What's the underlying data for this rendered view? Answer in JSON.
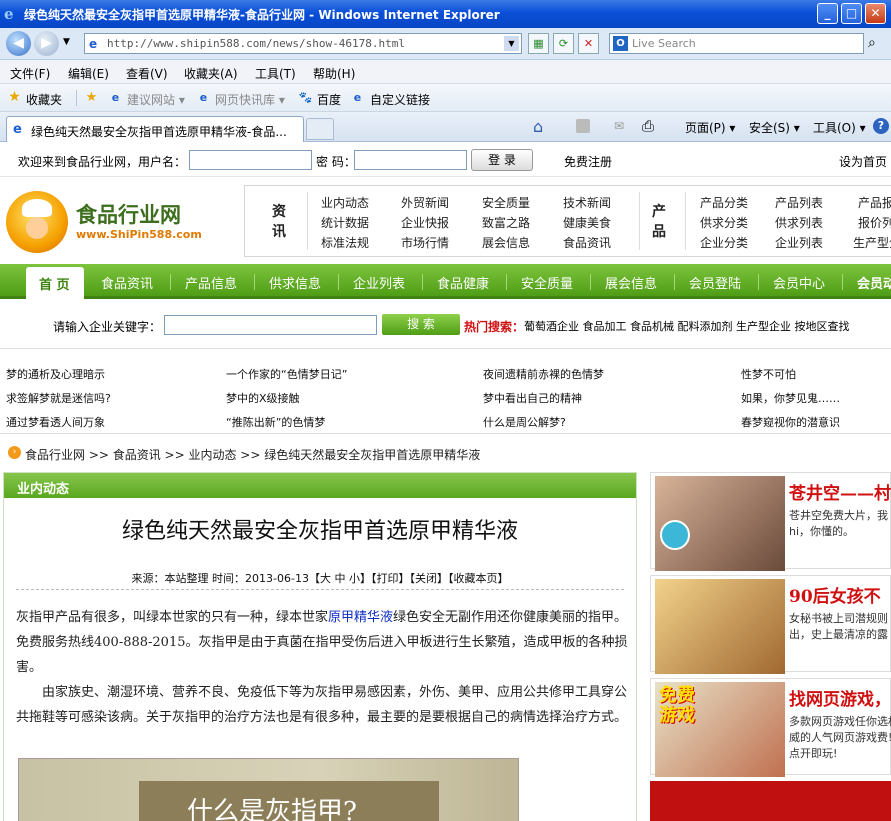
{
  "window": {
    "title": "绿色纯天然最安全灰指甲首选原甲精华液-食品行业网 - Windows Internet Explorer",
    "min": "_",
    "max": "□",
    "close": "✕"
  },
  "address": {
    "url": "http://www.shipin588.com/news/show-46178.html",
    "search_placeholder": "Live Search"
  },
  "menu": [
    "文件(F)",
    "编辑(E)",
    "查看(V)",
    "收藏夹(A)",
    "工具(T)",
    "帮助(H)"
  ],
  "favorites": {
    "label": "收藏夹",
    "items": [
      "建议网站 ▾",
      "网页快讯库 ▾",
      "百度",
      "自定义链接"
    ]
  },
  "tab": {
    "title": "绿色纯天然最安全灰指甲首选原甲精华液-食品...",
    "commands": [
      "页面(P) ▾",
      "安全(S) ▾",
      "工具(O) ▾"
    ]
  },
  "site": {
    "welcome": "欢迎来到食品行业网，用户名：",
    "password_label": "密 码：",
    "login_button": "登 录",
    "register": "免费注册",
    "set_home": "设为首页",
    "logo_name": "食品行业网",
    "logo_url": "www.ShiPin588.com",
    "cat1_label": "资讯",
    "cat1_links": [
      "业内动态",
      "外贸新闻",
      "安全质量",
      "技术新闻",
      "统计数据",
      "企业快报",
      "致富之路",
      "健康美食",
      "标准法规",
      "市场行情",
      "展会信息",
      "食品资讯"
    ],
    "cat2_label": "产品",
    "cat2_links": [
      "产品分类",
      "产品列表",
      "产品报",
      "供求分类",
      "供求列表",
      "报价列",
      "企业分类",
      "企业列表",
      "生产型企"
    ],
    "nav_home": "首 页",
    "nav": [
      "食品资讯",
      "产品信息",
      "供求信息",
      "企业列表",
      "食品健康",
      "安全质量",
      "展会信息",
      "会员登陆",
      "会员中心",
      "会员动"
    ],
    "search_label": "请输入企业关键字：",
    "search_button": "搜 索",
    "hot_label": "热门搜索：",
    "hot_terms": "葡萄酒企业 食品加工 食品机械 配料添加剂 生产型企业 按地区查找",
    "hot_links": [
      [
        "梦的通析及心理暗示",
        "一个作家的“色情梦日记”",
        "夜间遗精前赤裸的色情梦",
        "性梦不可怕"
      ],
      [
        "求签解梦就是迷信吗?",
        "梦中的X级接触",
        "梦中看出自己的精神",
        "如果，你梦见鬼……"
      ],
      [
        "通过梦看透人间万象",
        "“推陈出新”的色情梦",
        "什么是周公解梦?",
        "春梦窥视你的潜意识"
      ]
    ],
    "breadcrumb": "食品行业网 >> 食品资讯 >> 业内动态 >> 绿色纯天然最安全灰指甲首选原甲精华液"
  },
  "article": {
    "section": "业内动态",
    "title": "绿色纯天然最安全灰指甲首选原甲精华液",
    "meta": "来源：本站整理 时间：2013-06-13【大 中 小】【打印】【关闭】【收藏本页】",
    "p1_a": " 灰指甲产品有很多，叫绿本世家的只有一种，绿本世家",
    "p1_link": "原甲精华液",
    "p1_b": "绿色安全无副作用还你健康美丽的指甲。免费服务热线400-888-2015。灰指甲是由于真菌在指甲受伤后进入甲板进行生长繁殖，造成甲板的各种损害。",
    "p2": "　　由家族史、潮湿环境、营养不良、免疫低下等为灰指甲易感因素，外伤、美甲、应用公共修甲工具穿公共拖鞋等可感染该病。关于灰指甲的治疗方法也是有很多种，最主要的是要根据自己的病情选择治疗方式。",
    "image_caption": "什么是灰指甲?"
  },
  "ads": [
    {
      "title": "苍井空——村",
      "desc": "苍井空免费大片，我hi，你懂的。"
    },
    {
      "title": "90后女孩不",
      "desc": "女秘书被上司潜规则出，史上最清凉的露"
    },
    {
      "title": "找网页游戏，",
      "desc": "多款网页游戏任你选权威的人气网页游戏费!点开即玩!",
      "img_text": "免费\n游戏"
    }
  ],
  "colors": {
    "green": "#5aa81f",
    "red": "#d01010",
    "ie_blue": "#0a4fd8"
  }
}
